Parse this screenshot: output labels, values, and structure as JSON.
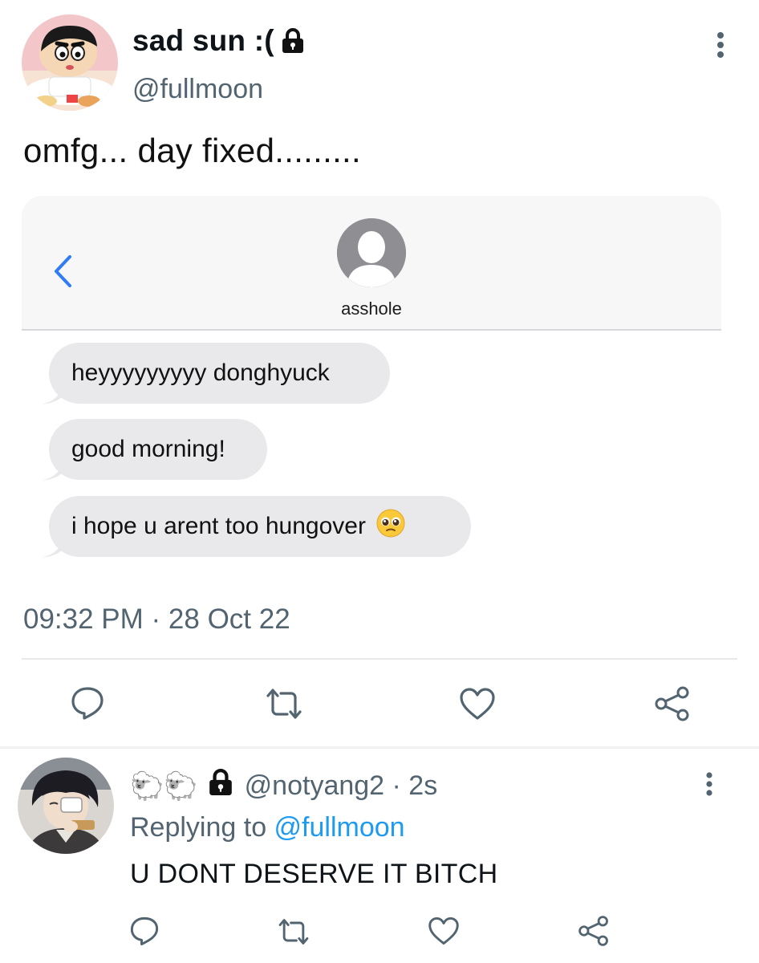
{
  "tweet": {
    "display_name": "sad sun :(",
    "handle": "@fullmoon",
    "text": "omfg... day fixed.........",
    "timestamp": "09:32 PM · 28 Oct 22",
    "media": {
      "contact_name": "asshole",
      "messages": [
        "heyyyyyyyyy donghyuck",
        "good morning!",
        "i hope u arent too hungover"
      ]
    }
  },
  "reply": {
    "emoji_prefix": "🐑🐑",
    "handle_and_time": "@notyang2 · 2s",
    "replying_prefix": "Replying to ",
    "replying_mention": "@fullmoon",
    "text": "U DONT DESERVE IT BITCH"
  },
  "colors": {
    "secondary_text": "#536471",
    "link": "#1d9bf0",
    "bubble": "#e9e9eb",
    "ios_blue": "#2f7cf6"
  },
  "icons": [
    "lock-icon",
    "more-icon",
    "back-chevron-icon",
    "reply-icon",
    "retweet-icon",
    "like-icon",
    "share-icon"
  ]
}
